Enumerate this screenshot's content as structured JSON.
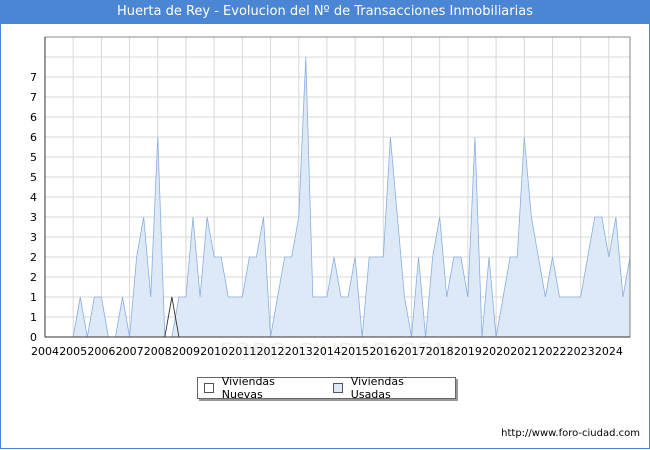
{
  "title": "Huerta de Rey - Evolucion del Nº de Transacciones Inmobiliarias",
  "footer": "http://www.foro-ciudad.com",
  "watermark": "FORO-CIUDAD.COM",
  "colors": {
    "title_bg": "#4a86d4",
    "usadas_fill": "#dde9f7",
    "usadas_line": "#8aaee0",
    "nuevas_fill": "#ffffff",
    "nuevas_line": "#333333",
    "grid": "#d8d8d8",
    "axis": "#333333"
  },
  "chart_data": {
    "type": "area",
    "x_start": 2004,
    "x_step": 0.25,
    "xlim": [
      2004,
      2024.75
    ],
    "ylim": [
      0,
      7.5
    ],
    "x_tick_labels": [
      "2004",
      "2005",
      "2006",
      "2007",
      "2008",
      "2009",
      "2010",
      "2011",
      "2012",
      "2013",
      "2014",
      "2015",
      "2016",
      "2017",
      "2018",
      "2019",
      "2020",
      "2021",
      "2022",
      "2023",
      "2024"
    ],
    "y_tick_labels": [
      "0",
      "1",
      "1",
      "2",
      "2",
      "3",
      "3",
      "4",
      "5",
      "5",
      "6",
      "6",
      "7",
      "7"
    ],
    "y_tick_values": [
      0,
      0.5,
      1,
      1.5,
      2,
      2.5,
      3,
      3.5,
      4,
      4.5,
      5,
      5.5,
      6,
      6.5,
      7,
      7.5
    ],
    "grid": true,
    "legend_position": "bottom",
    "series": [
      {
        "name": "Viviendas Nuevas",
        "values": [
          0,
          0,
          0,
          0,
          0,
          0,
          0,
          0,
          0,
          0,
          0,
          0,
          0,
          0,
          0,
          0,
          0,
          0,
          1,
          0,
          0,
          0,
          0,
          0,
          0,
          0,
          0,
          0,
          0,
          0,
          0,
          0,
          0,
          0,
          0,
          0,
          0,
          0,
          0,
          0,
          0,
          0,
          0,
          0,
          0,
          0,
          0,
          0,
          0,
          0,
          0,
          0,
          0,
          0,
          0,
          0,
          0,
          0,
          0,
          0,
          0,
          0,
          0,
          0,
          0,
          0,
          0,
          0,
          0,
          0,
          0,
          0,
          0,
          0,
          0,
          0,
          0,
          0,
          0,
          0,
          0,
          0,
          0,
          0
        ]
      },
      {
        "name": "Viviendas Usadas",
        "values": [
          0,
          0,
          0,
          0,
          0,
          1,
          0,
          1,
          1,
          0,
          0,
          1,
          0,
          2,
          3,
          1,
          5,
          0,
          0,
          1,
          1,
          3,
          1,
          3,
          2,
          2,
          1,
          1,
          1,
          2,
          2,
          3,
          0,
          1,
          2,
          2,
          3,
          7,
          1,
          1,
          1,
          2,
          1,
          1,
          2,
          0,
          2,
          2,
          2,
          5,
          3,
          1,
          0,
          2,
          0,
          2,
          3,
          1,
          2,
          2,
          1,
          5,
          0,
          2,
          0,
          1,
          2,
          2,
          5,
          3,
          2,
          1,
          2,
          1,
          1,
          1,
          1,
          2,
          3,
          3,
          2,
          3,
          1,
          2
        ]
      }
    ]
  },
  "legend": {
    "nuevas": "Viviendas Nuevas",
    "usadas": "Viviendas Usadas"
  }
}
